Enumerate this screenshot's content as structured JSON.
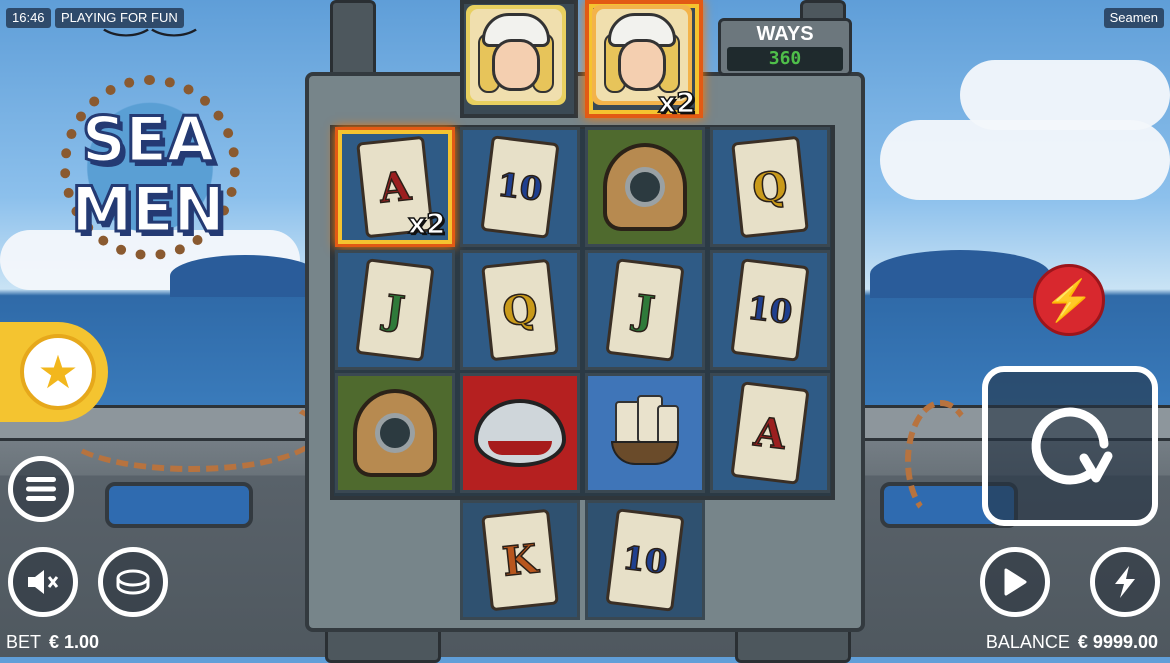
{
  "status_bar": {
    "time": "16:46",
    "mode": "PLAYING FOR FUN",
    "game_name": "Seamen"
  },
  "logo": {
    "line1": "SEA",
    "line2": "MEN"
  },
  "ways": {
    "label": "WAYS",
    "value": "360"
  },
  "reels": {
    "top_row": [
      {
        "symbol": "sailor-girl",
        "multiplier": ""
      },
      {
        "symbol": "sailor-girl",
        "multiplier": "x2",
        "highlighted": true
      }
    ],
    "rows": [
      [
        {
          "symbol": "A",
          "color": "#9b1f1f",
          "multiplier": "x2",
          "highlighted": true
        },
        {
          "symbol": "10",
          "color": "#1f3f8f"
        },
        {
          "symbol": "diving-helmet"
        },
        {
          "symbol": "Q",
          "color": "#c99a1a"
        }
      ],
      [
        {
          "symbol": "J",
          "color": "#2f7a3a"
        },
        {
          "symbol": "Q",
          "color": "#c99a1a"
        },
        {
          "symbol": "J",
          "color": "#2f7a3a"
        },
        {
          "symbol": "10",
          "color": "#1f3f8f"
        }
      ],
      [
        {
          "symbol": "diving-helmet"
        },
        {
          "symbol": "shark"
        },
        {
          "symbol": "ship"
        },
        {
          "symbol": "A",
          "color": "#9b1f1f"
        }
      ]
    ],
    "bottom_row": [
      {
        "symbol": "K",
        "color": "#b8561d"
      },
      {
        "symbol": "10",
        "color": "#1f3f8f"
      }
    ]
  },
  "controls": {
    "favorites_icon": "star-icon",
    "menu_icon": "menu-icon",
    "sound_icon": "mute-icon",
    "bet_icon": "coin-icon",
    "quick_spin_icon": "lightning-icon",
    "spin_icon": "spin-icon",
    "autoplay_icon": "play-icon",
    "turbo_icon": "turbo-icon"
  },
  "footer": {
    "bet_label": "BET",
    "bet_value": "€ 1.00",
    "balance_label": "BALANCE",
    "balance_value": "€ 9999.00"
  },
  "colors": {
    "gold": "#f4c430",
    "red_button": "#d8282e",
    "sea": "#2f6aa8",
    "ways_green": "#4fbf4a"
  }
}
